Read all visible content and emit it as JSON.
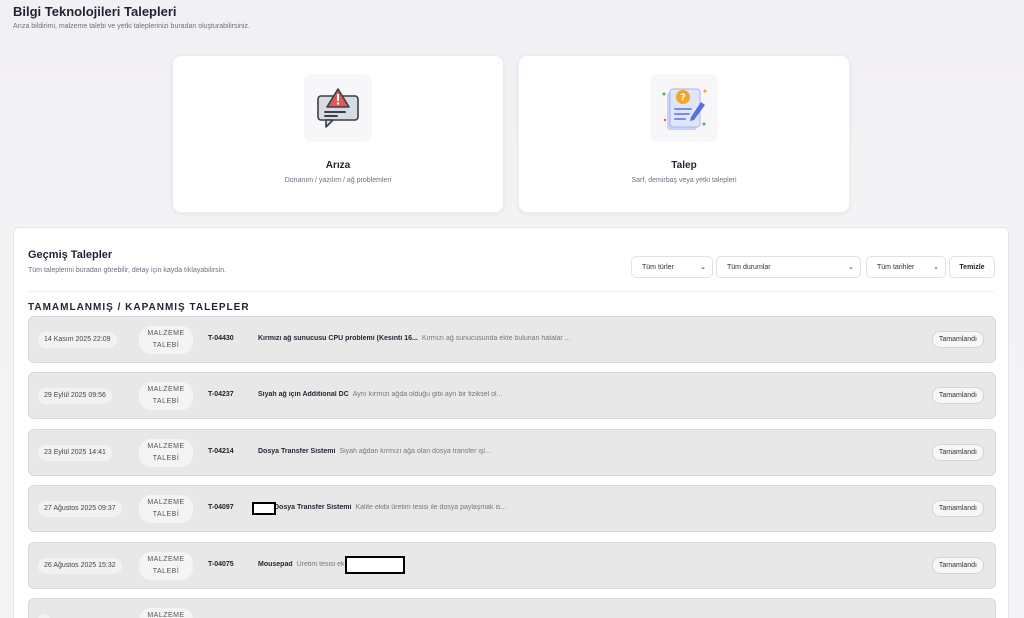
{
  "header": {
    "title": "Bilgi Teknolojileri Talepleri",
    "subtitle": "Arıza bildirimi, malzeme talebi ve yetki taleplerinizi buradan oluşturabilirsiniz."
  },
  "cards": [
    {
      "title": "Arıza",
      "description": "Donanım / yazılım / ağ problemleri",
      "icon": "warning-chat-icon"
    },
    {
      "title": "Talep",
      "description": "Sarf, demirbaş veya yetki talepleri",
      "icon": "request-document-icon"
    }
  ],
  "history": {
    "title": "Geçmiş Talepler",
    "subtitle": "Tüm taleplerini buradan görebilir, detay için kayda tıklayabilirsin.",
    "filters": {
      "type": "Tüm türler",
      "status": "Tüm durumlar",
      "date": "Tüm tarihler",
      "clear_label": "Temizle"
    },
    "section_title": "TAMAMLANMIŞ / KAPANMIŞ TALEPLER",
    "rows": [
      {
        "date": "14 Kasım 2025 22:09",
        "type_line1": "MALZEME",
        "type_line2": "TALEBİ",
        "no": "T-04430",
        "title": "Kırmızı ağ sunucusu CPU problemi (Kesinti 16...",
        "desc": "Kırmızı ağ sunucusunda ekte bulunan hatalar ...",
        "status": "Tamamlandı"
      },
      {
        "date": "29 Eylül 2025 09:56",
        "type_line1": "MALZEME",
        "type_line2": "TALEBİ",
        "no": "T-04237",
        "title": "Siyah ağ için Additional DC",
        "desc": "Aynı kırmızı ağda olduğu gibi ayrı bir fiziksel ol...",
        "status": "Tamamlandı"
      },
      {
        "date": "23 Eylül 2025 14:41",
        "type_line1": "MALZEME",
        "type_line2": "TALEBİ",
        "no": "T-04214",
        "title": "Dosya Transfer Sistemi",
        "desc": "Siyah ağdan kırmızı ağa olan dosya transfer işl...",
        "status": "Tamamlandı"
      },
      {
        "date": "27 Ağustos 2025 09:37",
        "type_line1": "MALZEME",
        "type_line2": "TALEBİ",
        "no": "T-04097",
        "title": "Dosya Transfer Sistemi",
        "desc": "Kalite ekibi üretim tesisi ile dosya paylaşmak is...",
        "status": "Tamamlandı"
      },
      {
        "date": "26 Ağustos 2025 15:32",
        "type_line1": "MALZEME",
        "type_line2": "TALEBİ",
        "no": "T-04075",
        "title": "Mousepad",
        "desc": "Üretim tesisi ekibine mousepa...",
        "status": "Tamamlandı"
      },
      {
        "date": "",
        "type_line1": "MALZEME",
        "type_line2": "",
        "no": "",
        "title": "",
        "desc": "",
        "status": ""
      }
    ]
  }
}
